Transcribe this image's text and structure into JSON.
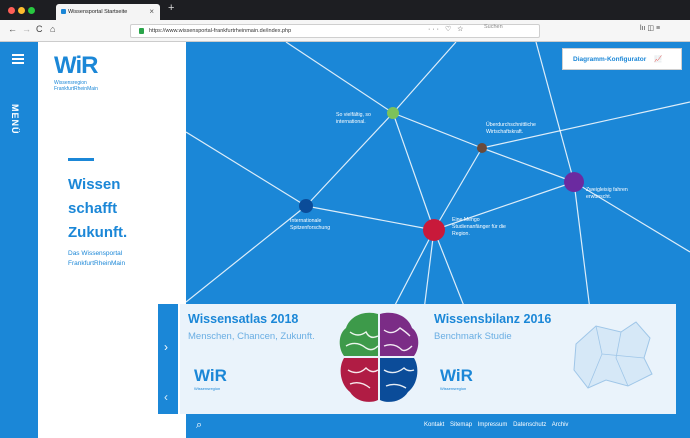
{
  "browser": {
    "tab_title": "Wissensportal Startseite",
    "tab_close": "×",
    "new_tab": "+",
    "url": "https://www.wissensportal-frankfurtrheinmain.de/index.php",
    "search_placeholder": "Suchen",
    "nav": {
      "back": "←",
      "forward": "→",
      "reload": "C",
      "home": "⌂"
    },
    "page_actions": "··· ♡ ☆",
    "toolbar_icons": "lıı ◫ ≡"
  },
  "sidebar": {
    "menu_label": "MENÜ"
  },
  "logo": {
    "mark": "WiR",
    "line1": "Wissensregion",
    "line2": "FrankfurtRheinMain"
  },
  "hero": {
    "title_lines": [
      "Wissen",
      "schafft",
      "Zukunft."
    ],
    "subtitle": "Das Wissensportal FrankfurtRheinMain"
  },
  "config_button": "Diagramm-Konfigurator",
  "network_labels": [
    "So vielfältig, so international.",
    "Überdurchschnittliche Wirtschaftskraft.",
    "Zweigleisig fahren erwünscht.",
    "Internationale Spitzenforschung",
    "Eine Mengo Studienanfänger für die Region."
  ],
  "slider": {
    "cards": [
      {
        "title": "Wissensatlas 2018",
        "subtitle": "Menschen, Chancen, Zukunft.",
        "logo": "WiR",
        "logo_sub": "Wissensregion"
      },
      {
        "title": "Wissensbilanz 2016",
        "subtitle": "Benchmark Studie",
        "logo": "WiR",
        "logo_sub": "Wissensregion"
      }
    ]
  },
  "footer": {
    "links": [
      "Kontakt",
      "Sitemap",
      "Impressum",
      "Datenschutz",
      "Archiv"
    ]
  },
  "colors": {
    "brand_blue": "#1b87d7",
    "dark_blue": "#0b4c99",
    "crimson": "#c8193a",
    "purple": "#6b2aa0",
    "green": "#7dc25a",
    "brown": "#6b4a3a"
  }
}
